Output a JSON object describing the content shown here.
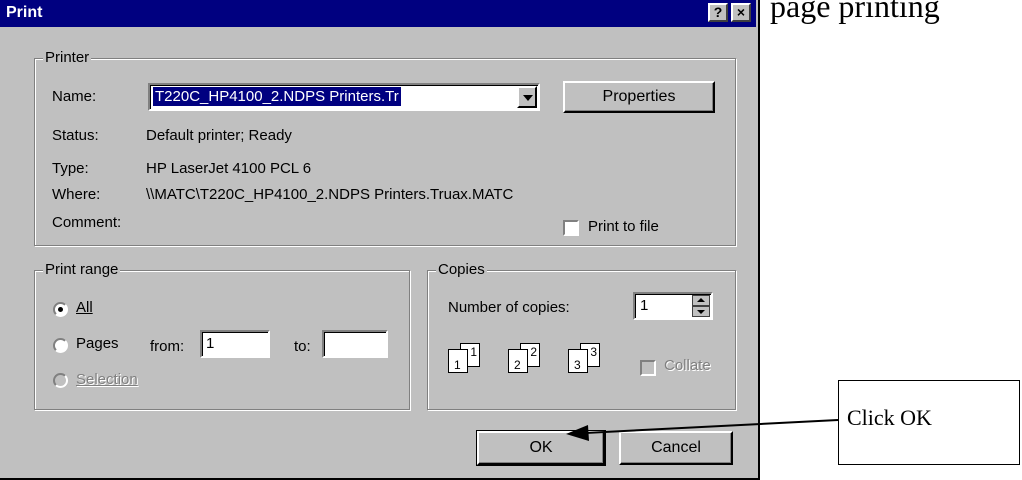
{
  "background": {
    "partial_text": "page printing"
  },
  "window": {
    "title": "Print",
    "help_label": "?",
    "close_label": "×"
  },
  "printer": {
    "group_label": "Printer",
    "name_label": "Name:",
    "name_value": "T220C_HP4100_2.NDPS Printers.Tr",
    "properties_button": "Properties",
    "status_label": "Status:",
    "status_value": "Default printer; Ready",
    "type_label": "Type:",
    "type_value": "HP LaserJet 4100 PCL 6",
    "where_label": "Where:",
    "where_value": "\\\\MATC\\T220C_HP4100_2.NDPS Printers.Truax.MATC",
    "comment_label": "Comment:",
    "print_to_file_label": "Print to file",
    "print_to_file_checked": false
  },
  "print_range": {
    "group_label": "Print range",
    "all_label": "All",
    "all_selected": true,
    "pages_label": "Pages",
    "from_label": "from:",
    "from_value": "1",
    "to_label": "to:",
    "to_value": "",
    "selection_label": "Selection",
    "selection_enabled": false
  },
  "copies": {
    "group_label": "Copies",
    "number_label": "Number of copies:",
    "number_value": "1",
    "collate_label": "Collate",
    "collate_enabled": false,
    "collate_pages": [
      "1",
      "1",
      "2",
      "2",
      "3",
      "3"
    ]
  },
  "buttons": {
    "ok": "OK",
    "cancel": "Cancel"
  },
  "annotation": {
    "callout_text": "Click OK"
  }
}
